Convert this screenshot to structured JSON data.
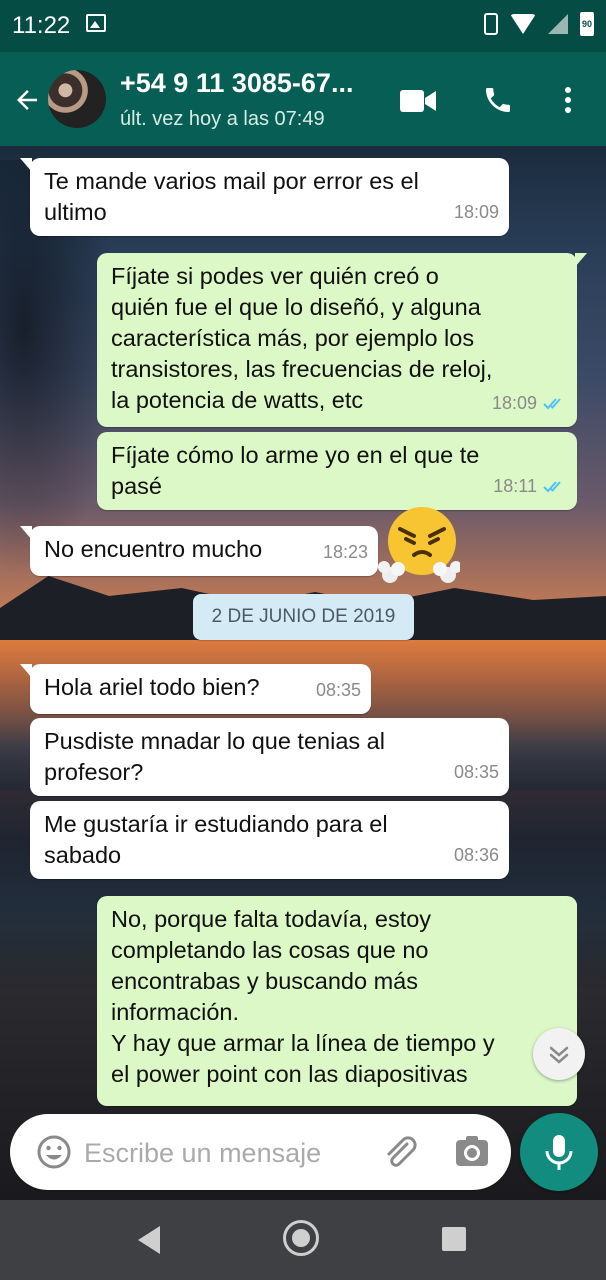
{
  "status_bar": {
    "time": "11:22",
    "battery": "90"
  },
  "header": {
    "contact_name": "+54 9 11 3085-67...",
    "last_seen": "últ. vez hoy a las 07:49"
  },
  "messages": [
    {
      "dir": "in",
      "text": "Te mande varios mail por error es el\nultimo",
      "time": "18:09"
    },
    {
      "dir": "out",
      "text": "Fíjate si podes ver quién creó o\nquién fue el que lo diseñó, y alguna\ncaracterística más, por ejemplo los\ntransistores, las frecuencias de reloj,\nla potencia de watts, etc",
      "time": "18:09",
      "status": "read"
    },
    {
      "dir": "out",
      "text": "Fíjate cómo lo arme yo en el que te\npasé",
      "time": "18:11",
      "status": "read"
    },
    {
      "dir": "in",
      "text": "No encuentro mucho",
      "time": "18:23"
    },
    {
      "dir": "in",
      "text": "Hola ariel todo bien?",
      "time": "08:35"
    },
    {
      "dir": "in",
      "text": "Pusdiste mnadar lo que tenias al\nprofesor?",
      "time": "08:35"
    },
    {
      "dir": "in",
      "text": "Me gustaría ir estudiando para el\nsabado",
      "time": "08:36"
    },
    {
      "dir": "out",
      "text": "No, porque falta todavía, estoy\ncompletando las cosas que no\nencontrabas y buscando más\ninformación.\nY hay que armar la línea de tiempo y\nel power point con las diapositivas",
      "time": ""
    }
  ],
  "date_divider": "2 DE JUNIO DE 2019",
  "composer": {
    "placeholder": "Escribe un mensaje"
  },
  "colors": {
    "header": "#075e54",
    "status_bar": "#054d44",
    "outgoing": "#dcf8c6",
    "incoming": "#ffffff",
    "accent": "#128c7e",
    "read_tick": "#4fc3f7"
  },
  "icons": [
    "back-arrow-icon",
    "video-call-icon",
    "phone-icon",
    "more-vert-icon",
    "angry-emoji-icon",
    "chevron-down-icon",
    "emoji-icon",
    "paperclip-icon",
    "camera-icon",
    "mic-icon"
  ]
}
